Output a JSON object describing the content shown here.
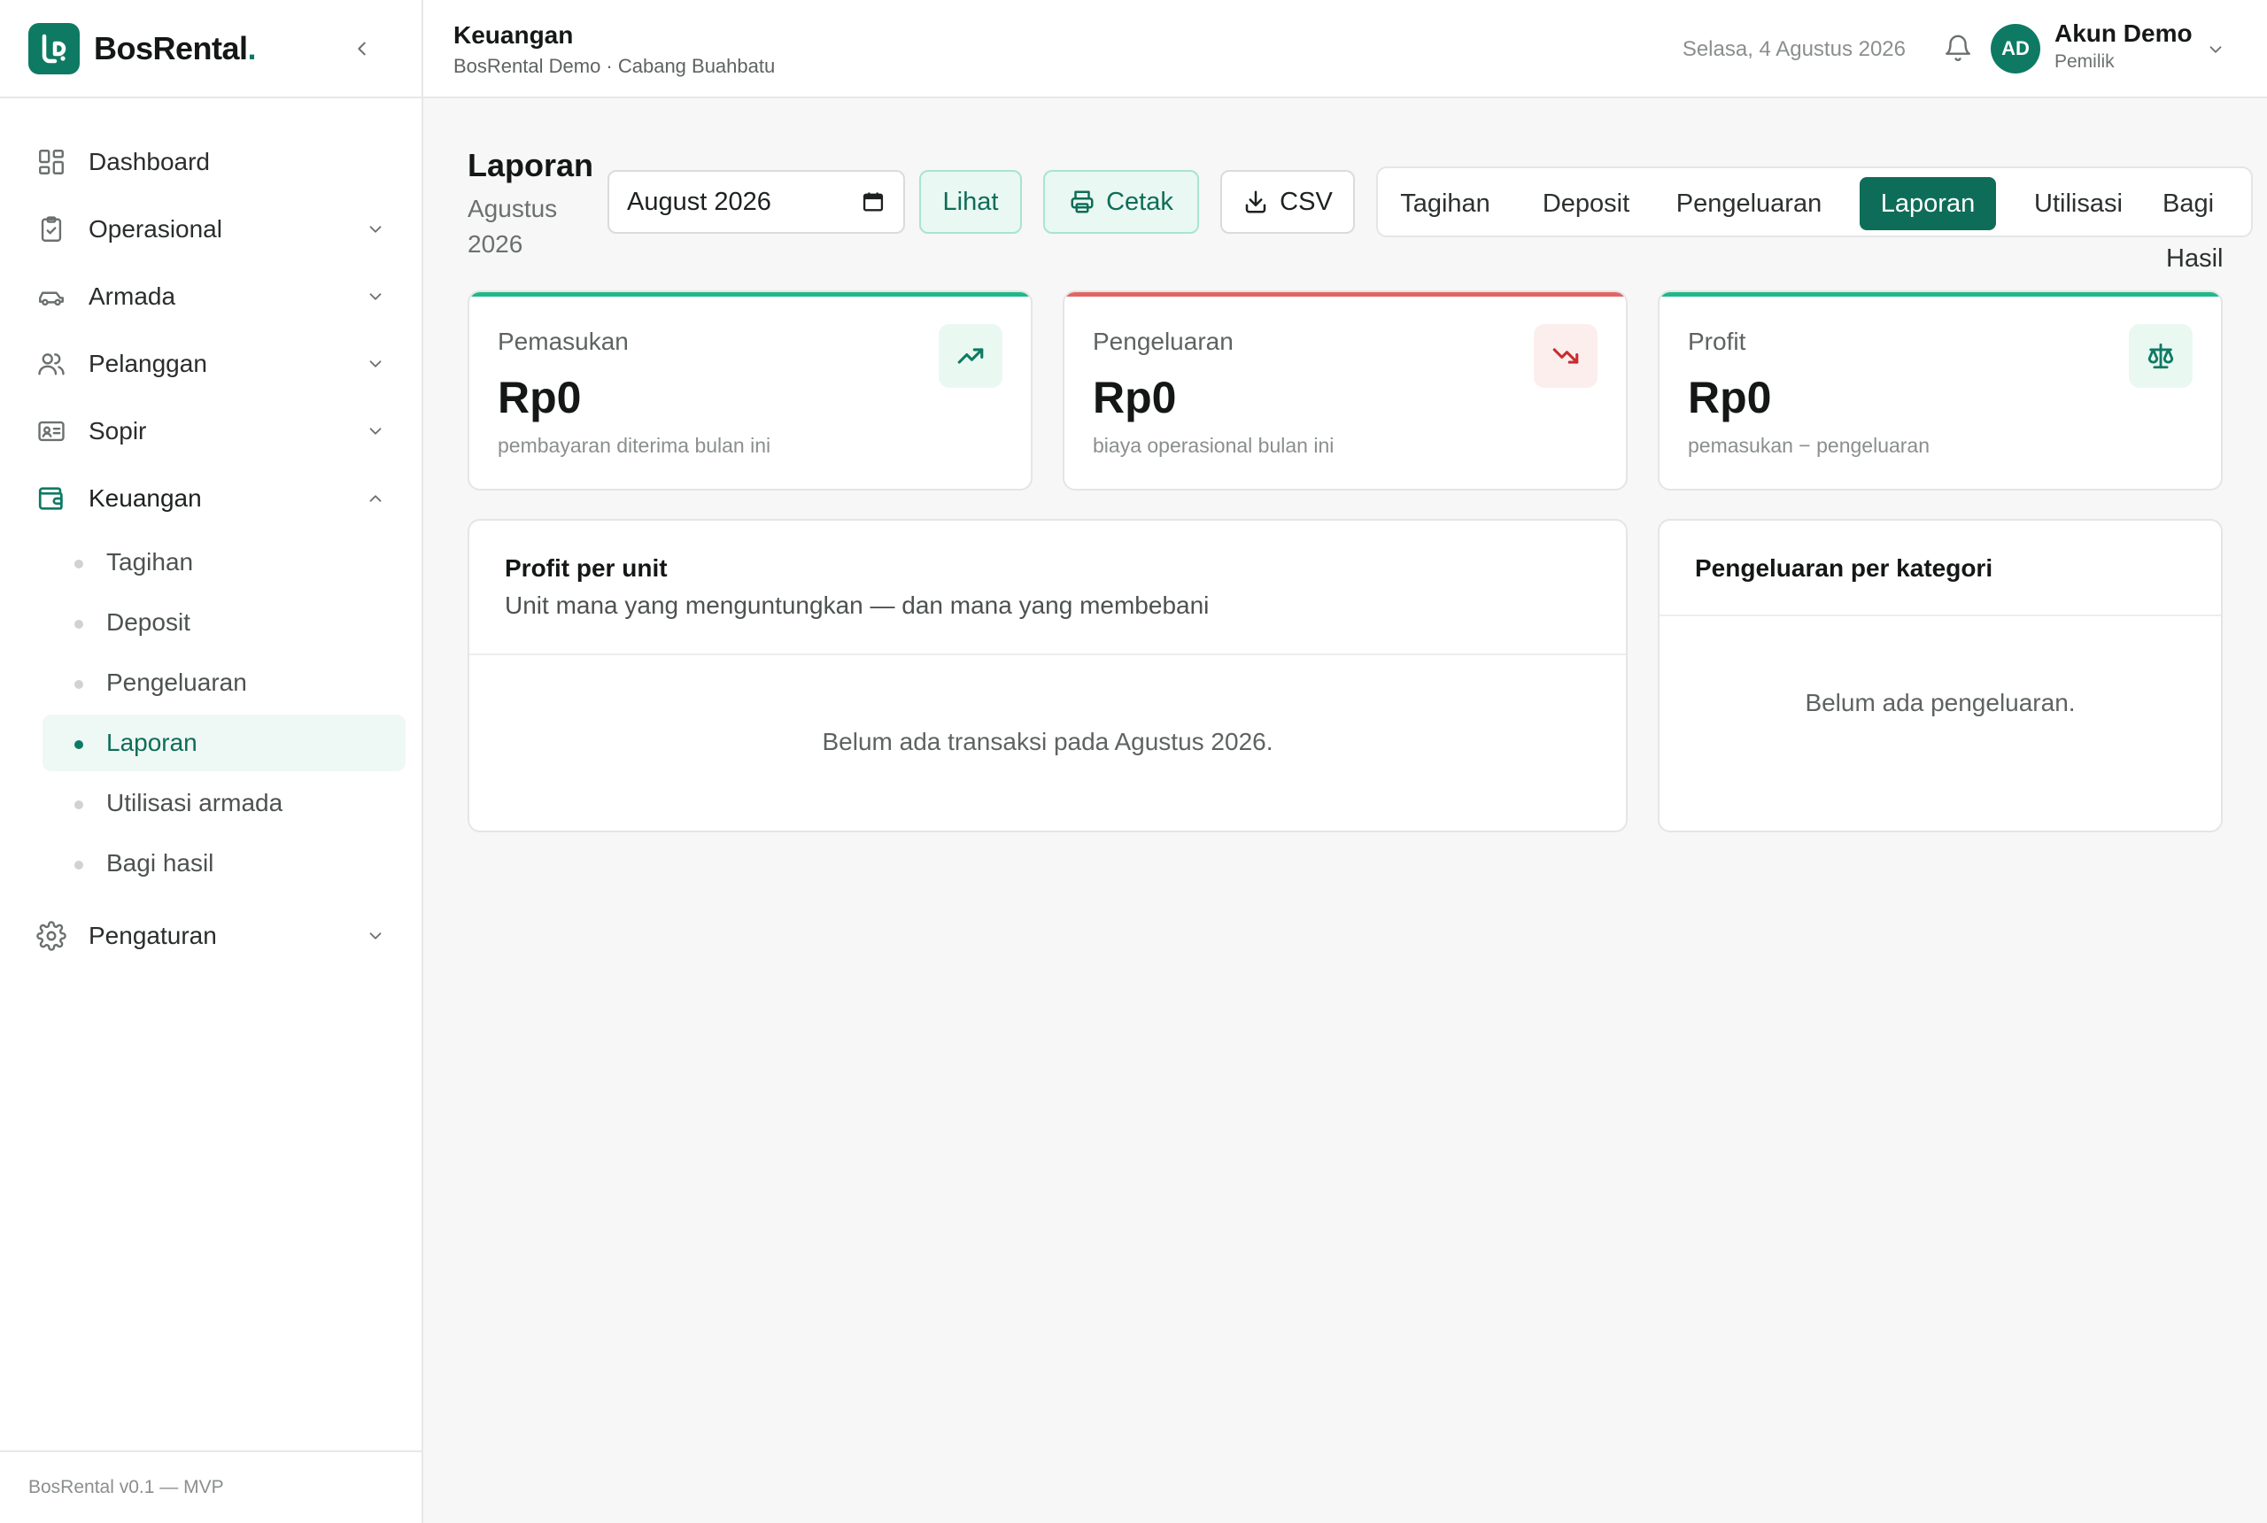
{
  "brand": {
    "name": "BosRental",
    "dot": "."
  },
  "sidebar": {
    "items": [
      {
        "label": "Dashboard"
      },
      {
        "label": "Operasional"
      },
      {
        "label": "Armada"
      },
      {
        "label": "Pelanggan"
      },
      {
        "label": "Sopir"
      },
      {
        "label": "Keuangan"
      },
      {
        "label": "Pengaturan"
      }
    ],
    "keuangan_sub": [
      {
        "label": "Tagihan"
      },
      {
        "label": "Deposit"
      },
      {
        "label": "Pengeluaran"
      },
      {
        "label": "Laporan"
      },
      {
        "label": "Utilisasi armada"
      },
      {
        "label": "Bagi hasil"
      }
    ],
    "version": "BosRental v0.1 — MVP"
  },
  "header": {
    "title": "Keuangan",
    "subtitle": "BosRental Demo · Cabang Buahbatu",
    "date": "Selasa, 4 Agustus 2026",
    "avatar_initials": "AD",
    "user_name": "Akun Demo",
    "user_role": "Pemilik"
  },
  "page": {
    "title": "Laporan",
    "period": "Agustus 2026",
    "month_value": "August  2026",
    "lihat_label": "Lihat",
    "cetak_label": "Cetak",
    "csv_label": "CSV"
  },
  "tabs": {
    "tagihan": "Tagihan",
    "deposit": "Deposit",
    "pengeluaran": "Pengeluaran",
    "laporan": "Laporan",
    "utilisasi": "Utilisasi",
    "bagi_line1": "Bagi",
    "bagi_line2": "Hasil"
  },
  "stats": {
    "pemasukan": {
      "label": "Pemasukan",
      "amount": "Rp0",
      "note": "pembayaran diterima bulan ini"
    },
    "pengeluaran": {
      "label": "Pengeluaran",
      "amount": "Rp0",
      "note": "biaya operasional bulan ini"
    },
    "profit": {
      "label": "Profit",
      "amount": "Rp0",
      "note": "pemasukan − pengeluaran"
    }
  },
  "profit_unit": {
    "title": "Profit per unit",
    "subtitle": "Unit mana yang menguntungkan — dan mana yang membebani",
    "empty": "Belum ada transaksi pada Agustus 2026."
  },
  "pengeluaran_kategori": {
    "title": "Pengeluaran per kategori",
    "empty": "Belum ada pengeluaran."
  },
  "colors": {
    "accent": "#0e7a63",
    "income": "#1fb88a",
    "expense": "#e36464"
  }
}
